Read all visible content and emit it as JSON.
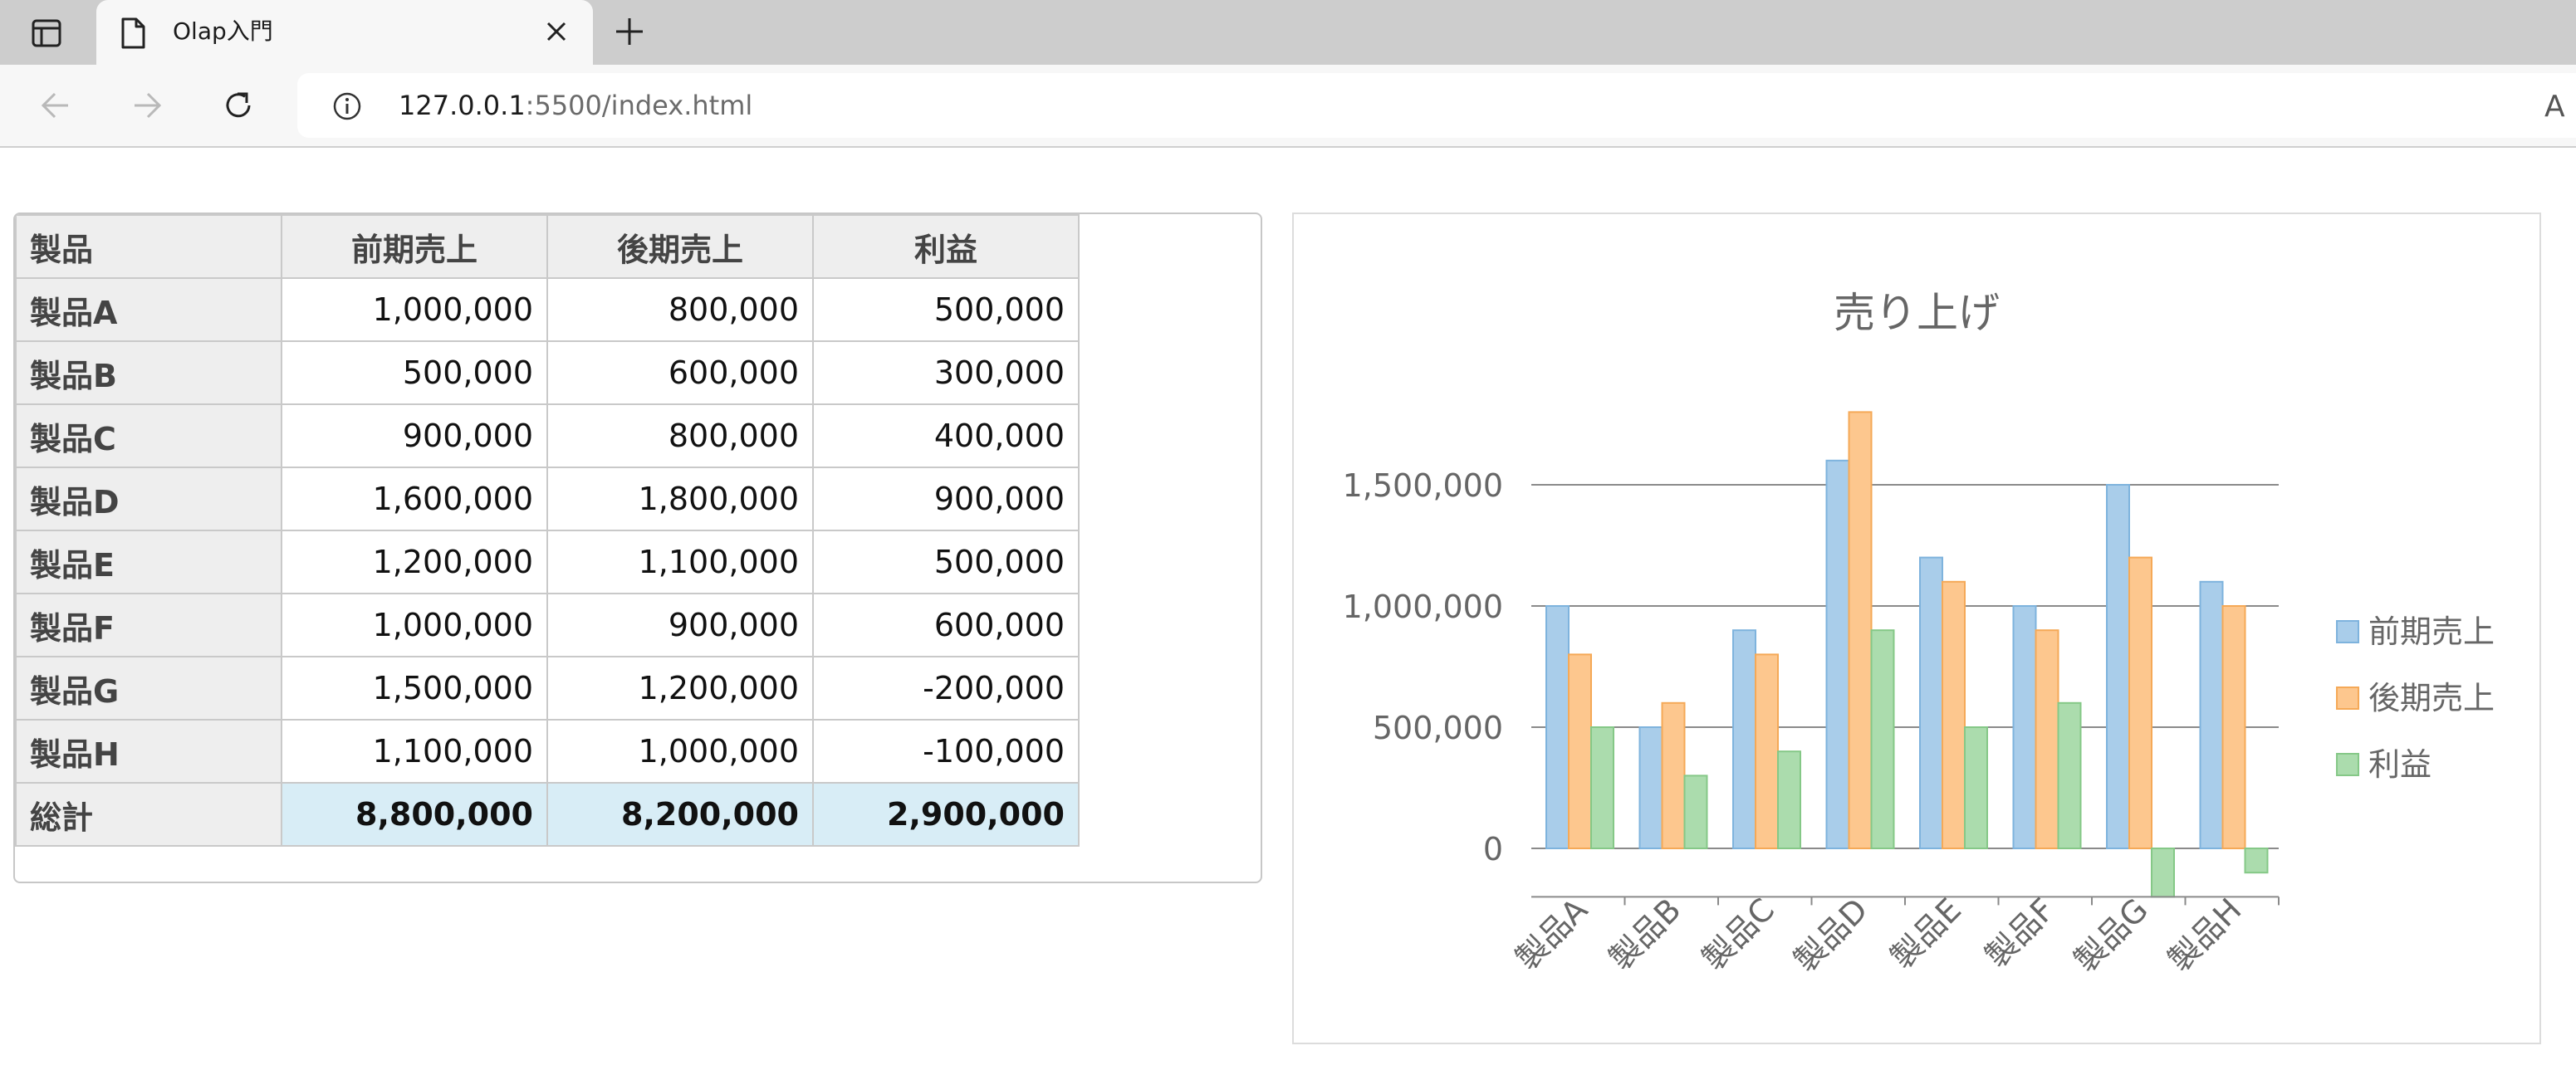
{
  "browser": {
    "tab": {
      "title": "Olap入門"
    },
    "address": {
      "host": "127.0.0.1",
      "rest": ":5500/index.html"
    },
    "read_aloud_label": "Á"
  },
  "grid": {
    "headers": [
      "製品",
      "前期売上",
      "後期売上",
      "利益"
    ],
    "rows": [
      {
        "label": "製品A",
        "values": [
          "1,000,000",
          "800,000",
          "500,000"
        ]
      },
      {
        "label": "製品B",
        "values": [
          "500,000",
          "600,000",
          "300,000"
        ]
      },
      {
        "label": "製品C",
        "values": [
          "900,000",
          "800,000",
          "400,000"
        ]
      },
      {
        "label": "製品D",
        "values": [
          "1,600,000",
          "1,800,000",
          "900,000"
        ]
      },
      {
        "label": "製品E",
        "values": [
          "1,200,000",
          "1,100,000",
          "500,000"
        ]
      },
      {
        "label": "製品F",
        "values": [
          "1,000,000",
          "900,000",
          "600,000"
        ]
      },
      {
        "label": "製品G",
        "values": [
          "1,500,000",
          "1,200,000",
          "-200,000"
        ]
      },
      {
        "label": "製品H",
        "values": [
          "1,100,000",
          "1,000,000",
          "-100,000"
        ]
      }
    ],
    "total": {
      "label": "総計",
      "values": [
        "8,800,000",
        "8,200,000",
        "2,900,000"
      ]
    }
  },
  "chart_data": {
    "type": "bar",
    "title": "売り上げ",
    "categories": [
      "製品A",
      "製品B",
      "製品C",
      "製品D",
      "製品E",
      "製品F",
      "製品G",
      "製品H"
    ],
    "series": [
      {
        "name": "前期売上",
        "values": [
          1000000,
          500000,
          900000,
          1600000,
          1200000,
          1000000,
          1500000,
          1100000
        ],
        "color": "#a9cdea",
        "stroke": "#7eb3dd"
      },
      {
        "name": "後期売上",
        "values": [
          800000,
          600000,
          800000,
          1800000,
          1100000,
          900000,
          1200000,
          1000000
        ],
        "color": "#fdc78e",
        "stroke": "#f5a957"
      },
      {
        "name": "利益",
        "values": [
          500000,
          300000,
          400000,
          900000,
          500000,
          600000,
          -200000,
          -100000
        ],
        "color": "#abdcad",
        "stroke": "#85c887"
      }
    ],
    "yticks": [
      "0",
      "500,000",
      "1,000,000",
      "1,500,000"
    ],
    "ylim": [
      -200000,
      1500000
    ],
    "grid": true,
    "legend": "right"
  }
}
